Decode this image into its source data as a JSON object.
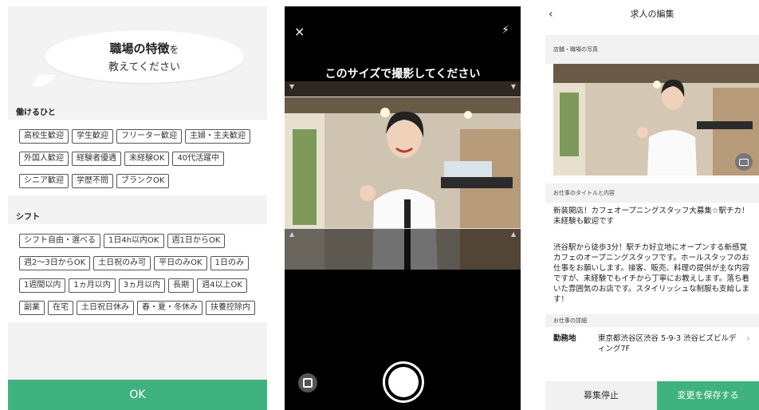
{
  "panel1": {
    "bubble_title": "職場の特徴",
    "bubble_title_suffix": "を",
    "bubble_sub": "教えてください",
    "sections": [
      {
        "heading": "働けるひと",
        "tags": [
          "高校生歓迎",
          "学生歓迎",
          "フリーター歓迎",
          "主婦・主夫歓迎",
          "外国人歓迎",
          "経験者優遇",
          "未経験OK",
          "40代活躍中",
          "シニア歓迎",
          "学歴不問",
          "ブランクOK"
        ]
      },
      {
        "heading": "シフト",
        "tags": [
          "シフト自由・選べる",
          "1日4h以内OK",
          "週1日からOK",
          "週2〜3日からOK",
          "土日祝のみ可",
          "平日のみOK",
          "1日のみ",
          "1週間以内",
          "1ヵ月以内",
          "3ヵ月以内",
          "長期",
          "週4以上OK",
          "副業",
          "在宅",
          "土日祝日休み",
          "春・夏・冬休み",
          "扶養控除内"
        ]
      }
    ],
    "ok_label": "OK"
  },
  "panel2": {
    "close_icon": "×",
    "flash_icon": "⚡",
    "caption": "このサイズで撮影してください"
  },
  "panel3": {
    "title": "求人の編集",
    "back_icon": "‹",
    "photo_label": "店舗・職場の写真",
    "title_section_label": "お仕事のタイトルと内容",
    "job_title": "新装開店！カフェオープニングスタッフ大募集☆駅チカ！未経験も歓迎です",
    "job_body": "渋谷駅から徒歩3分！駅チカ好立地にオープンする新感覚カフェのオープニングスタッフです。ホールスタッフのお仕事をお願いします。接客、販売、料理の提供が主な内容ですが、未経験でもイチから丁寧にお教えします。落ち着いた雰囲気のお店です。スタイリッシュな制服も支給します！",
    "detail_label": "お仕事の詳細",
    "location_key": "勤務地",
    "location_value": "東京都渋谷区渋谷 5-9-3 渋谷ビズビルディング7F",
    "stop_label": "募集停止",
    "save_label": "変更を保存する"
  }
}
